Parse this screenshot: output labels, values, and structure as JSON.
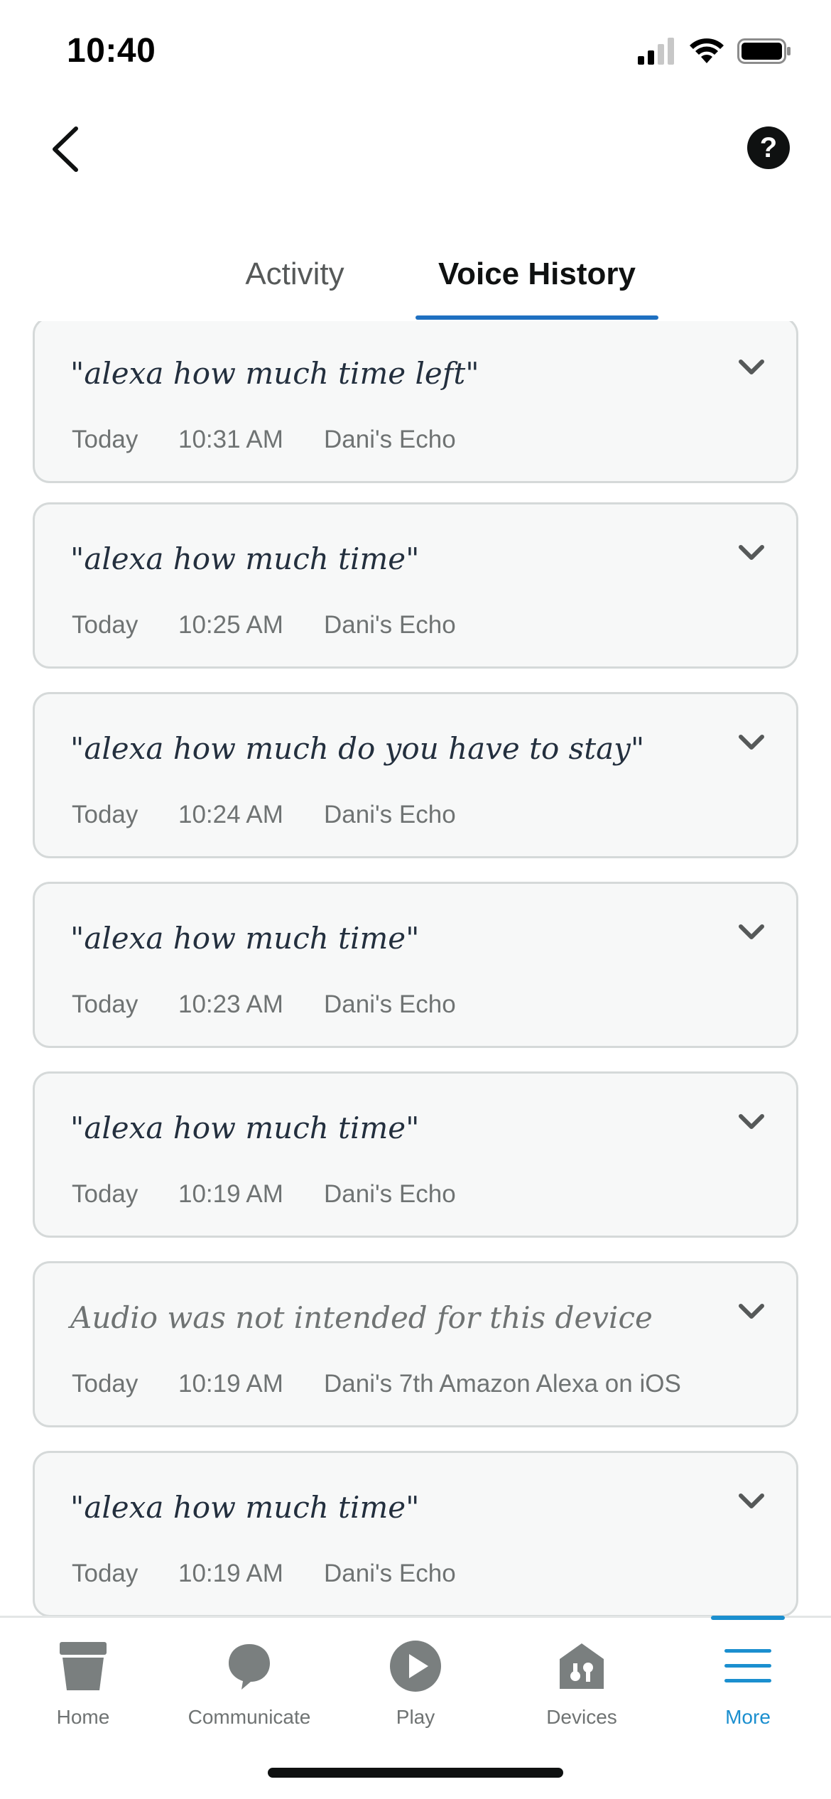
{
  "status_bar": {
    "time": "10:40"
  },
  "header": {
    "help_label": "?"
  },
  "tabs": [
    {
      "label": "Activity"
    },
    {
      "label": "Voice History"
    }
  ],
  "history": [
    {
      "utterance": "\"alexa how much time left\"",
      "day": "Today",
      "time": "10:31 AM",
      "device": "Dani's Echo"
    },
    {
      "utterance": "\"alexa how much time\"",
      "day": "Today",
      "time": "10:25 AM",
      "device": "Dani's Echo"
    },
    {
      "utterance": "\"alexa how much do you have to stay\"",
      "day": "Today",
      "time": "10:24 AM",
      "device": "Dani's Echo"
    },
    {
      "utterance": "\"alexa how much time\"",
      "day": "Today",
      "time": "10:23 AM",
      "device": "Dani's Echo"
    },
    {
      "utterance": "\"alexa how much time\"",
      "day": "Today",
      "time": "10:19 AM",
      "device": "Dani's Echo"
    },
    {
      "utterance": "Audio was not intended for this device",
      "day": "Today",
      "time": "10:19 AM",
      "device": "Dani's 7th Amazon Alexa on iOS"
    },
    {
      "utterance": "\"alexa how much time\"",
      "day": "Today",
      "time": "10:19 AM",
      "device": "Dani's Echo"
    }
  ],
  "bottom_nav": [
    {
      "label": "Home",
      "icon": "home-icon"
    },
    {
      "label": "Communicate",
      "icon": "chat-bubble-icon"
    },
    {
      "label": "Play",
      "icon": "play-icon"
    },
    {
      "label": "Devices",
      "icon": "devices-house-icon"
    },
    {
      "label": "More",
      "icon": "hamburger-menu-icon",
      "active": true
    }
  ],
  "colors": {
    "accent_blue": "#1f70c1",
    "nav_active": "#1b8fcf",
    "card_bg": "#f7f8f8",
    "card_border": "#d5d9d9"
  }
}
